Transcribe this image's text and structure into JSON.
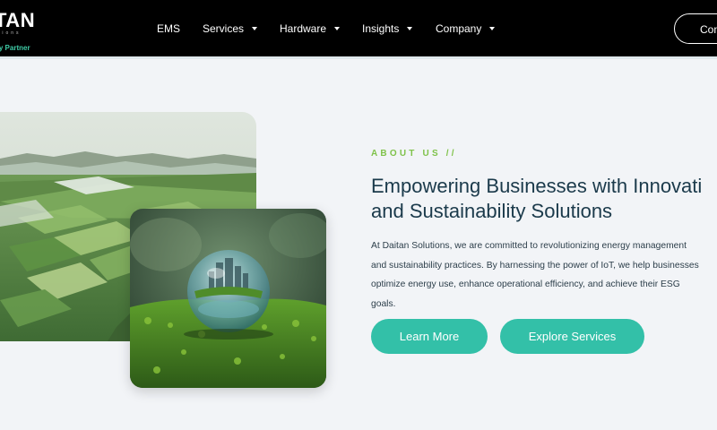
{
  "brand": {
    "name": "TAN",
    "sub": "tions",
    "tagline": "ity Partner"
  },
  "nav": {
    "items": [
      {
        "label": "EMS",
        "dropdown": false
      },
      {
        "label": "Services",
        "dropdown": true
      },
      {
        "label": "Hardware",
        "dropdown": true
      },
      {
        "label": "Insights",
        "dropdown": true
      },
      {
        "label": "Company",
        "dropdown": true
      }
    ],
    "cta_label": "Con"
  },
  "hero": {
    "eyebrow": "ABOUT US //",
    "headline_line1": "Empowering Businesses with Innovati",
    "headline_line2": "and Sustainability Solutions",
    "body_lines": [
      "At Daitan Solutions, we are committed to revolutionizing energy management",
      "and sustainability practices. By harnessing the power of IoT, we help businesses",
      "optimize energy use, enhance operational efficiency, and achieve their ESG",
      "goals."
    ],
    "primary_button": "Learn More",
    "secondary_button": "Explore Services"
  },
  "colors": {
    "accent": "#33c0a8",
    "eyebrow": "#7fc24a",
    "headline": "#1b3a4b",
    "header_bg": "#000000",
    "page_bg": "#f2f4f7",
    "tagline": "#3fcba6"
  },
  "images": {
    "back": "aerial-farmland-landscape",
    "front": "glass-globe-city-on-moss"
  }
}
